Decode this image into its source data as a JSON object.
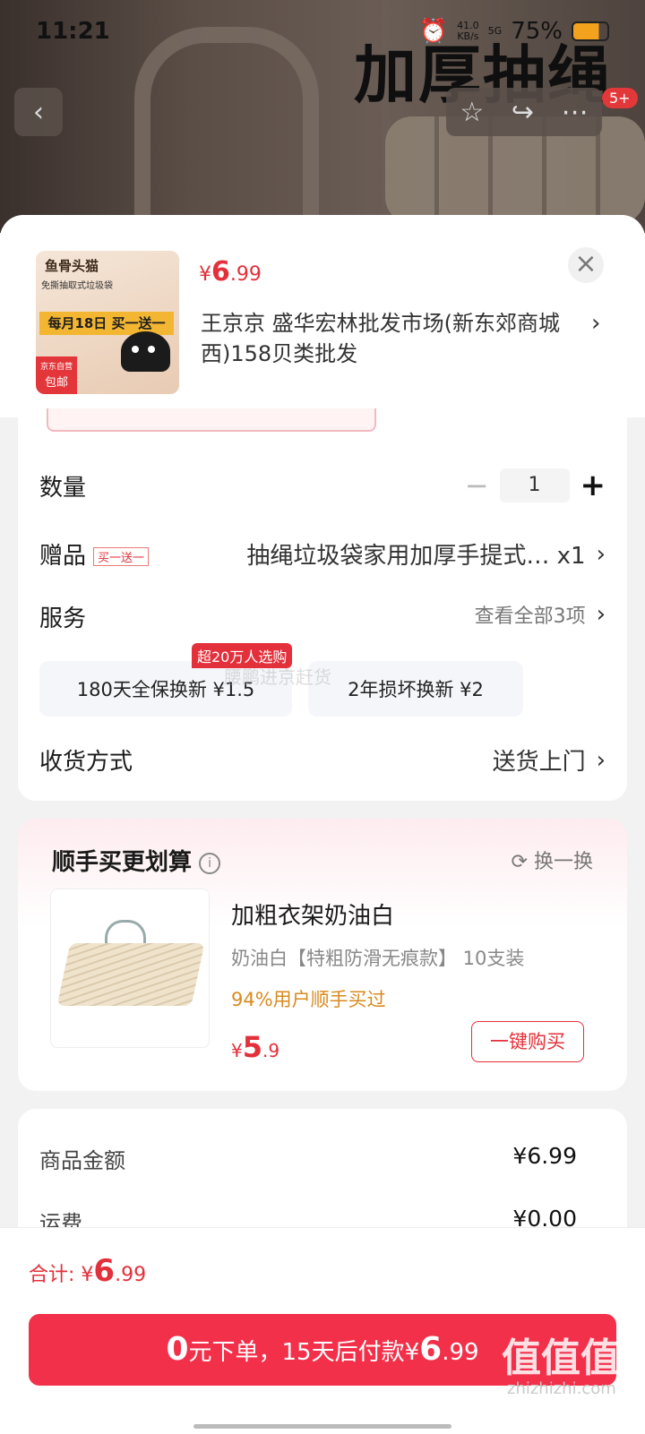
{
  "status": {
    "time": "11:21",
    "net_speed": "41.0",
    "net_unit": "KB/s",
    "signal": "5G",
    "battery": "75%"
  },
  "banner": {
    "title": "加厚抽绳",
    "badge": "5+"
  },
  "header": {
    "thumb": {
      "brand": "鱼骨头猫",
      "subtitle": "免撕抽取式垃圾袋",
      "promo": "每月18日 买一送一",
      "tag1": "京东自营",
      "tag2": "包邮"
    },
    "price_symbol": "¥",
    "price_int": "6",
    "price_dec": ".99",
    "address": "王京京  盛华宏林批发市场(新东郊商城西)158贝类批发"
  },
  "options": {
    "qty_label": "数量",
    "qty_value": "1",
    "gift_label": "赠品",
    "gift_tag": "买一送一",
    "gift_value": "抽绳垃圾袋家用加厚手提式… x1",
    "service_label": "服务",
    "service_link": "查看全部3项",
    "services": [
      "180天全保换新  ¥1.5",
      "2年损坏换新  ¥2"
    ],
    "service_hot": "超20万人选购",
    "delivery_label": "收货方式",
    "delivery_value": "送货上门"
  },
  "addon": {
    "title": "顺手买更划算",
    "swap": "换一换",
    "name": "加粗衣架奶油白",
    "spec": "奶油白【特粗防滑无痕款】  10支装",
    "bought": "94%用户顺手买过",
    "price_symbol": "¥",
    "price_int": "5",
    "price_dec": ".9",
    "buy_btn": "一键购买"
  },
  "summary": {
    "goods_label": "商品金额",
    "goods_value": "¥6.99",
    "freight_label": "运费",
    "freight_value": "¥0.00"
  },
  "footer": {
    "total_label": "合计: ¥",
    "total_int": "6",
    "total_dec": ".99",
    "pay_int": "0",
    "pay_text": "元下单，15天后付款¥",
    "pay_amt_int": "6",
    "pay_amt_dec": ".99"
  },
  "watermark": {
    "main": "值值值",
    "site": "zhizhizhi.com",
    "overlay": "腰鹏进京赶货"
  }
}
